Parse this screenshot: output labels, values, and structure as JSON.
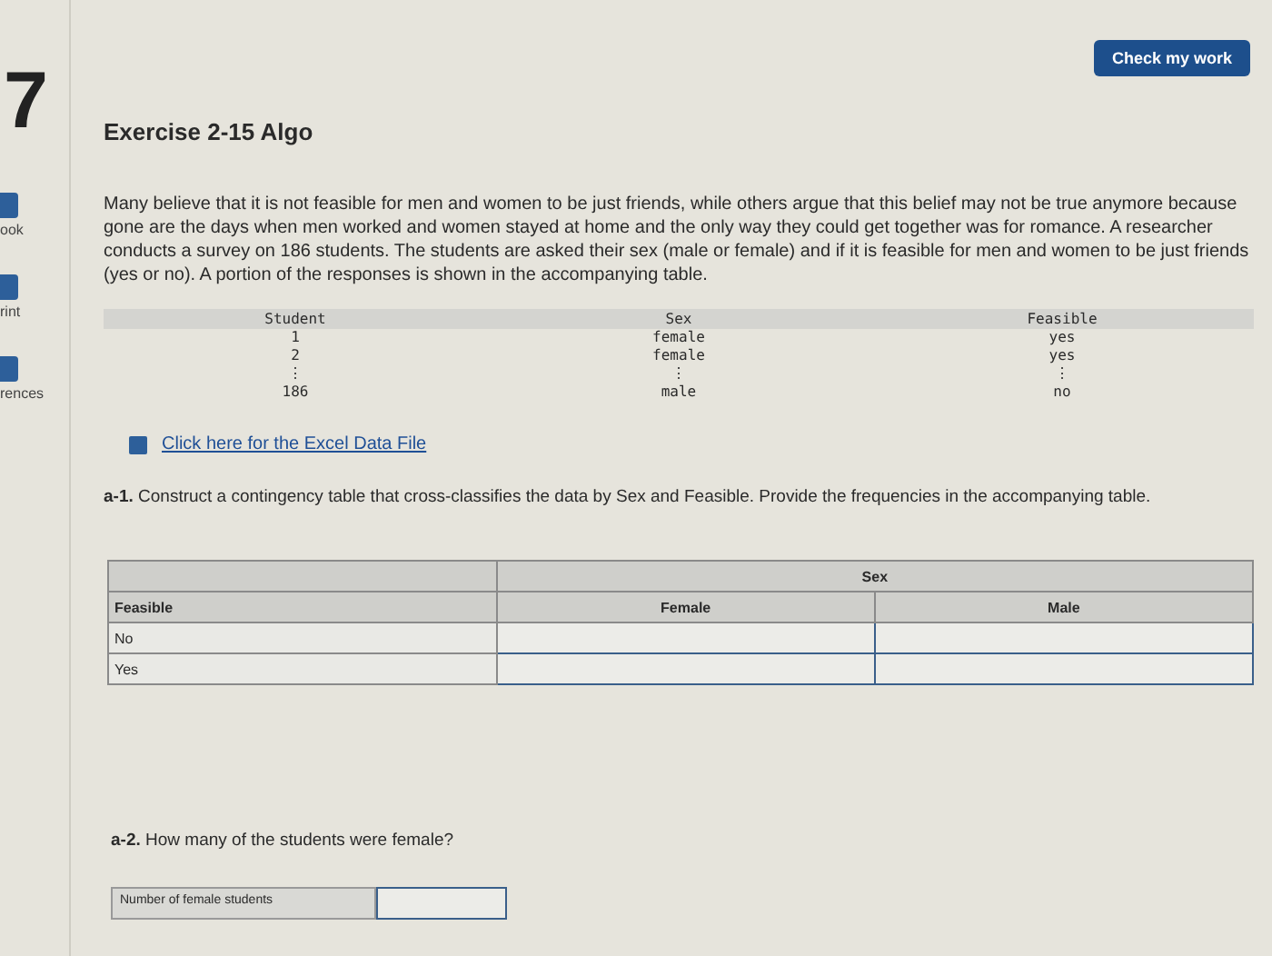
{
  "question_number": "7",
  "check_button": "Check my work",
  "sidebar": [
    {
      "label": "ook"
    },
    {
      "label": "rint"
    },
    {
      "label": "rences"
    }
  ],
  "title": "Exercise 2-15 Algo",
  "intro": "Many believe that it is not feasible for men and women to be just friends, while others argue that this belief may not be true anymore because gone are the days when men worked and women stayed at home and the only way they could get together was for romance. A researcher conducts a survey on 186 students. The students are asked their sex (male or female) and if it is feasible for men and women to be just friends (yes or no). A portion of the responses is shown in the accompanying table.",
  "data_table": {
    "columns": [
      "Student",
      "Sex",
      "Feasible"
    ],
    "rows": [
      [
        "1",
        "female",
        "yes"
      ],
      [
        "2",
        "female",
        "yes"
      ],
      [
        "⋮",
        "⋮",
        "⋮"
      ],
      [
        "186",
        "male",
        "no"
      ]
    ]
  },
  "excel_link": "Click here for the Excel Data File",
  "part_a1": {
    "label": "a-1.",
    "text": "Construct a contingency table that cross-classifies the data by Sex and Feasible. Provide the frequencies in the accompanying table.",
    "group_header": "Sex",
    "row_header": "Feasible",
    "columns": [
      "Female",
      "Male"
    ],
    "rows": [
      "No",
      "Yes"
    ]
  },
  "part_a2": {
    "label": "a-2.",
    "text": "How many of the students were female?",
    "field_label": "Number of female students"
  }
}
